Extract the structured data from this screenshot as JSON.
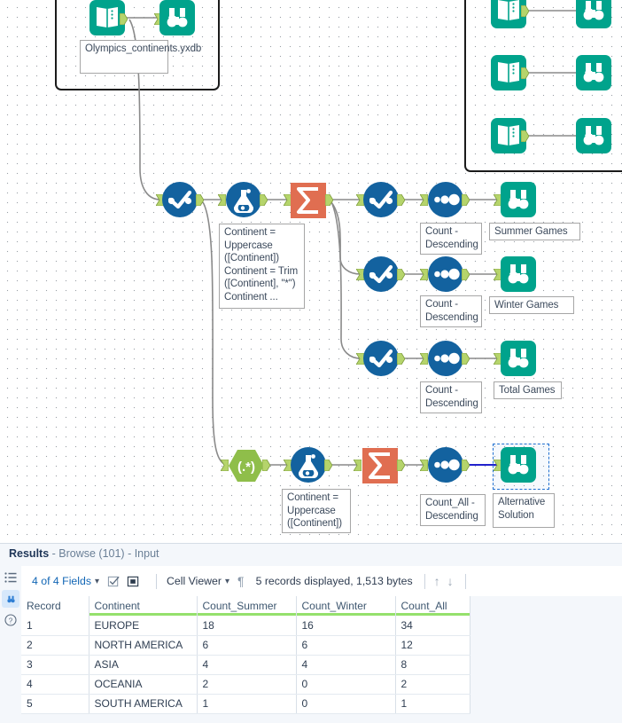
{
  "canvas": {
    "input_label": "Olympics_continents.yxdb",
    "annotations": {
      "formula_top": "Continent = Uppercase ([Continent])\nContinent = Trim ([Continent], \"*\")\nContinent ...",
      "formula_bottom": "Continent = Uppercase ([Continent])",
      "sort_summer": "Count - Descending",
      "sort_winter": "Count - Descending",
      "sort_total": "Count - Descending",
      "sort_all": "Count_All - Descending",
      "browse_summer": "Summer Games",
      "browse_winter": "Winter Games",
      "browse_total": "Total Games",
      "browse_alt": "Alternative Solution"
    },
    "tools": [
      {
        "id": "input-main",
        "type": "input-data-tool",
        "icon": "book-icon"
      },
      {
        "id": "browse-main",
        "type": "browse-tool",
        "icon": "binoculars-icon"
      },
      {
        "id": "input-2",
        "type": "input-data-tool",
        "icon": "book-icon"
      },
      {
        "id": "browse-2",
        "type": "browse-tool",
        "icon": "binoculars-icon"
      },
      {
        "id": "input-3",
        "type": "input-data-tool",
        "icon": "book-icon"
      },
      {
        "id": "browse-3",
        "type": "browse-tool",
        "icon": "binoculars-icon"
      },
      {
        "id": "input-4",
        "type": "input-data-tool",
        "icon": "book-icon"
      },
      {
        "id": "browse-4",
        "type": "browse-tool",
        "icon": "binoculars-icon"
      },
      {
        "id": "select-1",
        "type": "select-tool",
        "icon": "checkmark-icon"
      },
      {
        "id": "formula-1",
        "type": "formula-tool",
        "icon": "flask-icon"
      },
      {
        "id": "summarize-1",
        "type": "summarize-tool",
        "icon": "sigma-icon"
      },
      {
        "id": "select-summer",
        "type": "select-tool",
        "icon": "checkmark-icon"
      },
      {
        "id": "sort-summer",
        "type": "sort-tool",
        "icon": "three-dots-icon"
      },
      {
        "id": "browse-summer",
        "type": "browse-tool",
        "icon": "binoculars-icon"
      },
      {
        "id": "select-winter",
        "type": "select-tool",
        "icon": "checkmark-icon"
      },
      {
        "id": "sort-winter",
        "type": "sort-tool",
        "icon": "three-dots-icon"
      },
      {
        "id": "browse-winter",
        "type": "browse-tool",
        "icon": "binoculars-icon"
      },
      {
        "id": "select-total",
        "type": "select-tool",
        "icon": "checkmark-icon"
      },
      {
        "id": "sort-total",
        "type": "sort-tool",
        "icon": "three-dots-icon"
      },
      {
        "id": "browse-total",
        "type": "browse-tool",
        "icon": "binoculars-icon"
      },
      {
        "id": "regex-1",
        "type": "regex-tool",
        "icon": "regex-icon"
      },
      {
        "id": "formula-2",
        "type": "formula-tool",
        "icon": "flask-icon"
      },
      {
        "id": "summarize-2",
        "type": "summarize-tool",
        "icon": "sigma-icon"
      },
      {
        "id": "sort-all",
        "type": "sort-tool",
        "icon": "three-dots-icon"
      },
      {
        "id": "browse-alt",
        "type": "browse-tool",
        "icon": "binoculars-icon",
        "selected": true
      }
    ],
    "colors": {
      "teal": "#00a38c",
      "blue": "#13629f",
      "salmon": "#e06e51",
      "green": "#8fbe4a",
      "anchor": "#b5d46b",
      "wire": "#8a8a8a",
      "wire_selected": "#2222cc"
    }
  },
  "results": {
    "title_bold": "Results",
    "title_rest": " - Browse (101) - Input",
    "rail": [
      {
        "name": "list-view-icon",
        "active": false
      },
      {
        "name": "browse-icon",
        "active": true
      },
      {
        "name": "help-icon",
        "active": false
      }
    ],
    "toolbar": {
      "fields_label": "4 of 4 Fields",
      "cell_viewer_label": "Cell Viewer",
      "records_label": "5 records displayed, 1,513 bytes"
    },
    "grid": {
      "columns": [
        "Record",
        "Continent",
        "Count_Summer",
        "Count_Winter",
        "Count_All"
      ],
      "rows": [
        [
          "1",
          "EUROPE",
          "18",
          "16",
          "34"
        ],
        [
          "2",
          "NORTH AMERICA",
          "6",
          "6",
          "12"
        ],
        [
          "3",
          "ASIA",
          "4",
          "4",
          "8"
        ],
        [
          "4",
          "OCEANIA",
          "2",
          "0",
          "2"
        ],
        [
          "5",
          "SOUTH AMERICA",
          "1",
          "0",
          "1"
        ]
      ]
    }
  }
}
